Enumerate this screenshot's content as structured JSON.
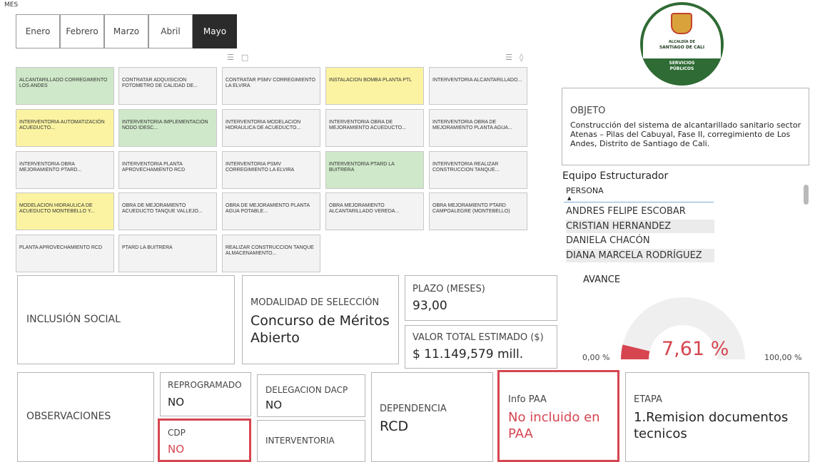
{
  "filter": {
    "title": "MES",
    "months": [
      "Enero",
      "Febrero",
      "Marzo",
      "Abril",
      "Mayo"
    ],
    "selected": "Mayo"
  },
  "projects": [
    {
      "label": "ALCANTARILLADO CORREGIMIENTO LOS ANDES",
      "color": "green"
    },
    {
      "label": "CONTRATAR ADQUISICION FOTOMETRO DE CALIDAD DE...",
      "color": "gray"
    },
    {
      "label": "CONTRATAR PSMV CORREGIMIENTO LA ELVIRA",
      "color": "gray"
    },
    {
      "label": "INSTALACION BOMBA PLANTA PTL",
      "color": "yellow"
    },
    {
      "label": "INTERVENTORIA ALCANTARILLADO...",
      "color": "gray"
    },
    {
      "label": "INTERVENTORIA AUTOMATIZACIÓN ACUEDUCTO...",
      "color": "yellow"
    },
    {
      "label": "INTERVENTORIA IMPLEMENTACIÓN NODO IDESC...",
      "color": "green"
    },
    {
      "label": "INTERVENTORIA MODELACION HIDRAULICA DE ACUEDUCTO...",
      "color": "gray"
    },
    {
      "label": "INTERVENTORIA OBRA DE MEJORAMIENTO ACUEDUCTO...",
      "color": "gray"
    },
    {
      "label": "INTERVENTORIA OBRA DE MEJORAMIENTO PLANTA AGUA...",
      "color": "gray"
    },
    {
      "label": "INTERVENTORIA OBRA MEJORAMIENTO PTARD...",
      "color": "gray"
    },
    {
      "label": "INTERVENTORIA PLANTA APROVECHAMIENTO RCD",
      "color": "gray"
    },
    {
      "label": "INTERVENTORIA PSMV CORREGIMIENTO LA ELVIRA",
      "color": "gray"
    },
    {
      "label": "INTERVENTORIA PTARD LA BUITRERA",
      "color": "green"
    },
    {
      "label": "INTERVENTORIA REALIZAR CONSTRUCCION TANQUE...",
      "color": "gray"
    },
    {
      "label": "MODELACION HIDRAULICA DE ACUEDUCTO MONTEBELLO Y...",
      "color": "yellow"
    },
    {
      "label": "OBRA DE MEJORAMIENTO ACUEDUCTO TANQUE VALLEJO...",
      "color": "gray"
    },
    {
      "label": "OBRA DE MEJORAMIENTO PLANTA AGUA POTABLE...",
      "color": "gray"
    },
    {
      "label": "OBRA MEJORAMIENTO ALCANTARILLADO VEREDA...",
      "color": "gray"
    },
    {
      "label": "OBRA MEJORAMIENTO PTARD CAMPOALEGRE (MONTEBELLO)",
      "color": "gray"
    },
    {
      "label": "PLANTA APROVECHAMIENTO RCD",
      "color": "gray"
    },
    {
      "label": "PTARD LA BUITRERA",
      "color": "gray"
    },
    {
      "label": "REALIZAR CONSTRUCCION TANQUE ALMACENAMIENTO...",
      "color": "gray"
    }
  ],
  "logo": {
    "line1": "ALCALDÍA DE",
    "line2": "SANTIAGO DE CALI",
    "line3": "SERVICIOS",
    "line4": "PÚBLICOS"
  },
  "objeto": {
    "label": "OBJETO",
    "text": "Construcción del sistema de alcantarillado sanitario sector Atenas – Pilas del Cabuyal, Fase II, corregimiento de Los Andes, Distrito de Santiago de Cali."
  },
  "equipo": {
    "title": "Equipo Estructurador",
    "column": "PERSONA",
    "people": [
      "ANDRES FELIPE ESCOBAR",
      "CRISTIAN HERNANDEZ",
      "DANIELA CHACÓN",
      "DIANA MARCELA RODRÍGUEZ"
    ]
  },
  "avance": {
    "title": "AVANCE",
    "value_text": "7,61 %",
    "value": 0.0761,
    "min": "0,00 %",
    "max": "100,00 %"
  },
  "cards": {
    "inclusion": {
      "label": "INCLUSIÓN SOCIAL"
    },
    "modalidad": {
      "label": "MODALIDAD DE SELECCIÓN",
      "value": "Concurso de Méritos Abierto"
    },
    "plazo": {
      "label": "PLAZO (MESES)",
      "value": "93,00"
    },
    "valor": {
      "label": "VALOR TOTAL ESTIMADO ($)",
      "value": "$ 11.149,579 mill."
    },
    "observaciones": {
      "label": "OBSERVACIONES"
    },
    "reprogramado": {
      "label": "REPROGRAMADO",
      "value": "NO"
    },
    "cdp": {
      "label": "CDP",
      "value": "NO"
    },
    "delegacion": {
      "label": "DELEGACION DACP",
      "value": "NO"
    },
    "interventoria": {
      "label": "INTERVENTORIA"
    },
    "dependencia": {
      "label": "DEPENDENCIA",
      "value": "RCD"
    },
    "infopaa": {
      "label": "Info PAA",
      "value": "No incluido en PAA"
    },
    "etapa": {
      "label": "ETAPA",
      "value": "1.Remision documentos tecnicos"
    }
  },
  "colors": {
    "green": "#cfe8c9",
    "yellow": "#fbf3a1",
    "gray": "#f3f3f3",
    "accent_red": "#d64550",
    "gauge_track": "#efefef"
  }
}
